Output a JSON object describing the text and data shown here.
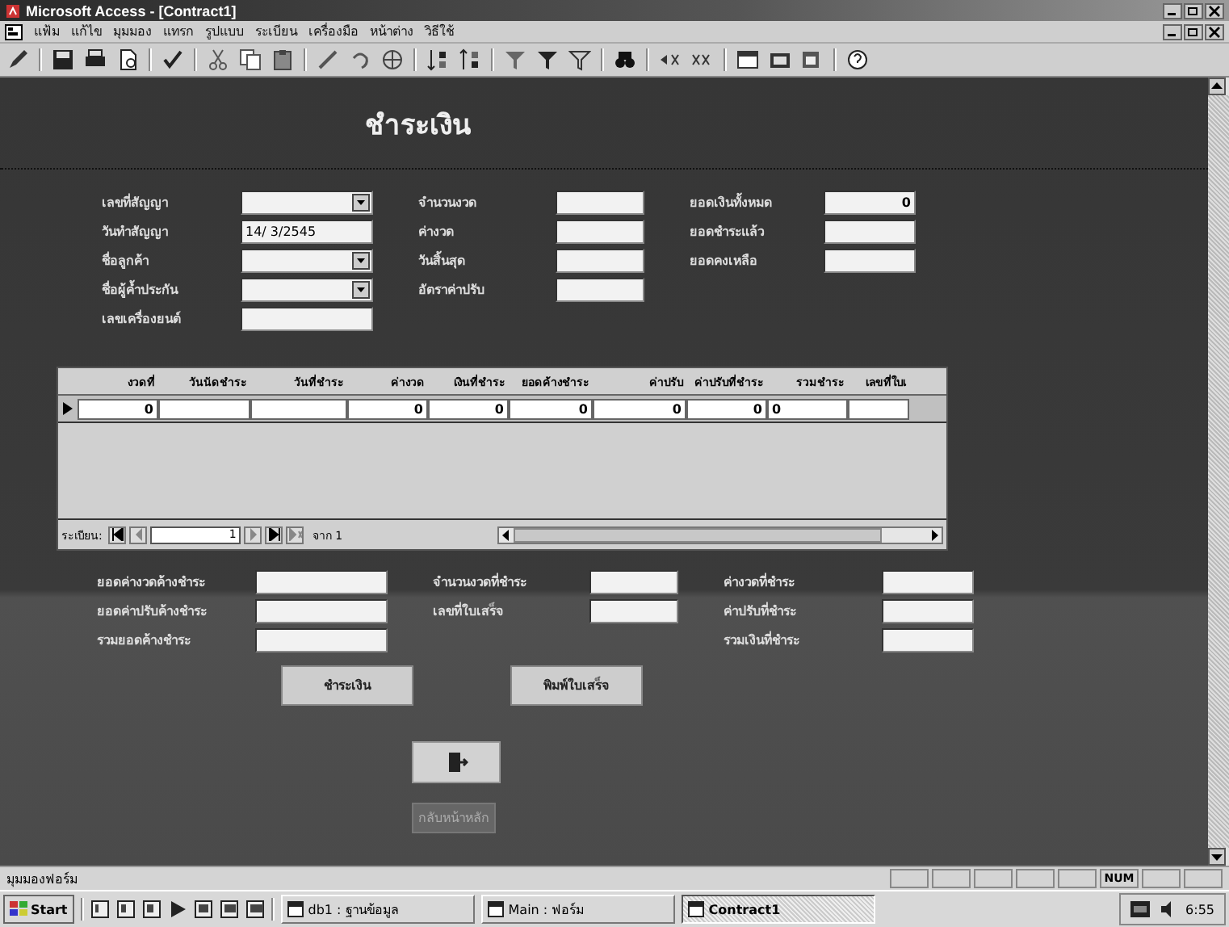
{
  "window": {
    "title": "Microsoft Access - [Contract1]"
  },
  "menu": [
    "แฟ้ม",
    "แก้ไข",
    "มุมมอง",
    "แทรก",
    "รูปแบบ",
    "ระเบียน",
    "เครื่องมือ",
    "หน้าต่าง",
    "วิธีใช้"
  ],
  "form": {
    "title": "ชำระเงิน",
    "field_columns": [
      [
        {
          "label": "เลขที่สัญญา",
          "kind": "combo"
        },
        {
          "label": "วันทำสัญญา",
          "value": "14/ 3/2545",
          "kind": "text"
        },
        {
          "label": "ชื่อลูกค้า",
          "kind": "combo"
        },
        {
          "label": "ชื่อผู้ค้ำประกัน",
          "kind": "combo"
        },
        {
          "label": "เลขเครื่องยนต์",
          "kind": "text"
        }
      ],
      [
        {
          "label": "จำนวนงวด",
          "kind": "text"
        },
        {
          "label": "ค่างวด",
          "kind": "text"
        },
        {
          "label": "วันสิ้นสุด",
          "kind": "text"
        },
        {
          "label": "อัตราค่าปรับ",
          "kind": "text"
        }
      ],
      [
        {
          "label": "ยอดเงินทั้งหมด",
          "value": "0",
          "kind": "number"
        },
        {
          "label": "ยอดชำระแล้ว",
          "kind": "text"
        },
        {
          "label": "ยอดคงเหลือ",
          "kind": "text"
        }
      ]
    ],
    "subform": {
      "columns": [
        {
          "label": "งวดที่",
          "kind": "number"
        },
        {
          "label": "วันนัดชำระ",
          "kind": "text"
        },
        {
          "label": "วันที่ชำระ",
          "kind": "text"
        },
        {
          "label": "ค่างวด",
          "kind": "number"
        },
        {
          "label": "เงินที่ชำระ",
          "kind": "number"
        },
        {
          "label": "ยอดค้างชำระ",
          "kind": "number"
        },
        {
          "label": "ค่าปรับ",
          "kind": "number"
        },
        {
          "label": "ค่าปรับที่ชำระ",
          "kind": "number"
        },
        {
          "label": "รวมชำระ",
          "kind": "text"
        },
        {
          "label": "เลขที่ใบเ",
          "kind": "text"
        }
      ],
      "rows": [
        {
          "cells": [
            "0",
            null,
            null,
            "0",
            "0",
            "0",
            "0",
            "0",
            "0",
            null
          ]
        }
      ],
      "navigation": {
        "label": "ระเบียน:",
        "record": "1",
        "total": "จาก 1"
      }
    },
    "summary_columns": [
      [
        {
          "label": "ยอดค่างวดค้างชำระ"
        },
        {
          "label": "ยอดค่าปรับค้างชำระ"
        },
        {
          "label": "รวมยอดค้างชำระ"
        }
      ],
      [
        {
          "label": "จำนวนงวดที่ชำระ"
        },
        {
          "label": "เลขที่ใบเสร็จ"
        }
      ],
      [
        {
          "label": "ค่างวดที่ชำระ"
        },
        {
          "label": "ค่าปรับที่ชำระ"
        },
        {
          "label": "รวมเงินที่ชำระ"
        }
      ]
    ],
    "buttons": [
      "ชำระเงิน",
      "พิมพ์ใบเสร็จ"
    ],
    "exit": {
      "caption": "กลับหน้าหลัก",
      "disabled": true
    }
  },
  "status_bar": {
    "text": "มุมมองฟอร์ม",
    "indicator": "NUM"
  },
  "taskbar": {
    "start": "Start",
    "tasks": [
      {
        "label": "db1 : ฐานข้อมูล",
        "selected": false
      },
      {
        "label": "Main : ฟอร์ม",
        "selected": false
      },
      {
        "label": "Contract1",
        "selected": true
      }
    ],
    "clock": "6:55"
  }
}
